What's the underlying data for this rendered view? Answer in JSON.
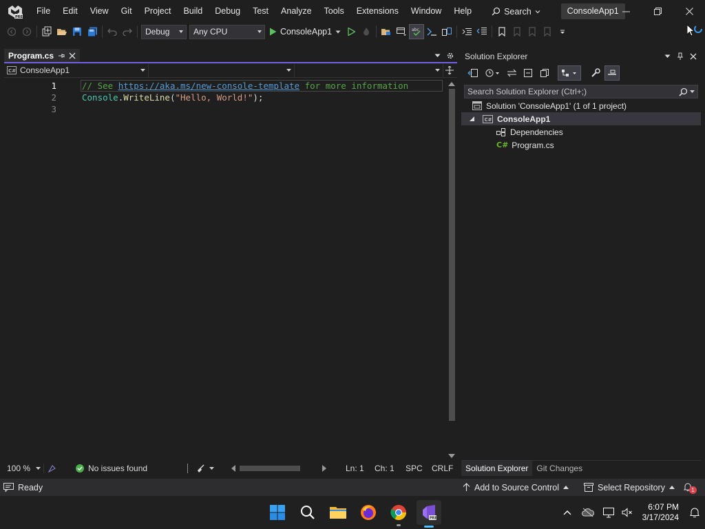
{
  "window": {
    "solution_title": "ConsoleApp1"
  },
  "menu": {
    "items": [
      "File",
      "Edit",
      "View",
      "Git",
      "Project",
      "Build",
      "Debug",
      "Test",
      "Analyze",
      "Tools",
      "Extensions",
      "Window",
      "Help"
    ],
    "search_label": "Search"
  },
  "toolbar": {
    "configuration": "Debug",
    "platform": "Any CPU",
    "run_target": "ConsoleApp1",
    "run_color": "#5ec15e"
  },
  "editor": {
    "tab_label": "Program.cs",
    "nav_project": "ConsoleApp1",
    "line_numbers": [
      "1",
      "2",
      "3"
    ],
    "code": {
      "line1_comment_prefix": "// See ",
      "line1_link": "https://aka.ms/new-console-template",
      "line1_comment_suffix": " for more information",
      "line2_type": "Console",
      "line2_dot": ".",
      "line2_method": "WriteLine",
      "line2_open": "(",
      "line2_string": "\"Hello, World!\"",
      "line2_close": ");"
    },
    "status": {
      "zoom": "100 %",
      "issues": "No issues found",
      "line": "Ln: 1",
      "col": "Ch: 1",
      "whitespace": "SPC",
      "line_endings": "CRLF"
    }
  },
  "solution_explorer": {
    "title": "Solution Explorer",
    "search_placeholder": "Search Solution Explorer (Ctrl+;)",
    "tree": {
      "solution": "Solution 'ConsoleApp1' (1 of 1 project)",
      "project": "ConsoleApp1",
      "dependencies": "Dependencies",
      "file": "Program.cs"
    },
    "tabs": [
      "Solution Explorer",
      "Git Changes"
    ]
  },
  "statusbar": {
    "ready": "Ready",
    "source_control": "Add to Source Control",
    "repository": "Select Repository",
    "notification_count": "1"
  },
  "taskbar": {
    "time": "6:07 PM",
    "date": "3/17/2024"
  },
  "colors": {
    "accent": "#7160e8",
    "background": "#1f1f1f"
  }
}
